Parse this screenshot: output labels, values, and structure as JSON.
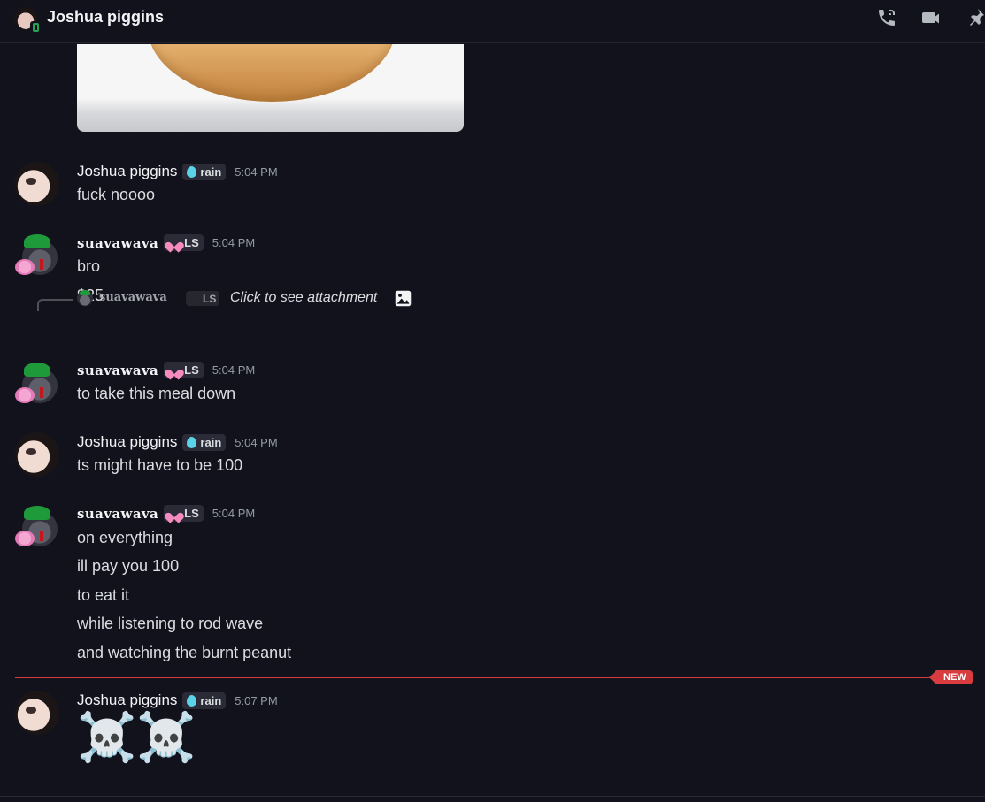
{
  "header": {
    "title": "Joshua piggins",
    "icons": [
      "phone-icon",
      "video-icon",
      "pin-icon"
    ]
  },
  "reply": {
    "name": "suavawava",
    "tag": "LS",
    "text": "Click to see attachment"
  },
  "messages": [
    {
      "author": "Joshua piggins",
      "tag": "rain",
      "time": "5:04 PM",
      "lines": [
        "fuck noooo"
      ]
    },
    {
      "author": "suavawava",
      "tag": "LS",
      "time": "5:04 PM",
      "lines": [
        "bro",
        "$25"
      ]
    },
    {
      "author": "suavawava",
      "tag": "LS",
      "time": "5:04 PM",
      "lines": [
        "to take this meal down"
      ]
    },
    {
      "author": "Joshua piggins",
      "tag": "rain",
      "time": "5:04 PM",
      "lines": [
        "ts might have to be 100"
      ]
    },
    {
      "author": "suavawava",
      "tag": "LS",
      "time": "5:04 PM",
      "lines": [
        "on everything",
        "ill pay you 100",
        "to eat it",
        "while listening to rod wave",
        "and watching the burnt peanut"
      ]
    },
    {
      "author": "Joshua piggins",
      "tag": "rain",
      "time": "5:07 PM",
      "lines": [
        "☠️☠️"
      ]
    }
  ],
  "divider": {
    "label": "NEW"
  },
  "colors": {
    "background": "#12121c",
    "divider": "#d83c3e",
    "rain_drop": "#5ad2e8",
    "heart": "#f68bc0"
  }
}
